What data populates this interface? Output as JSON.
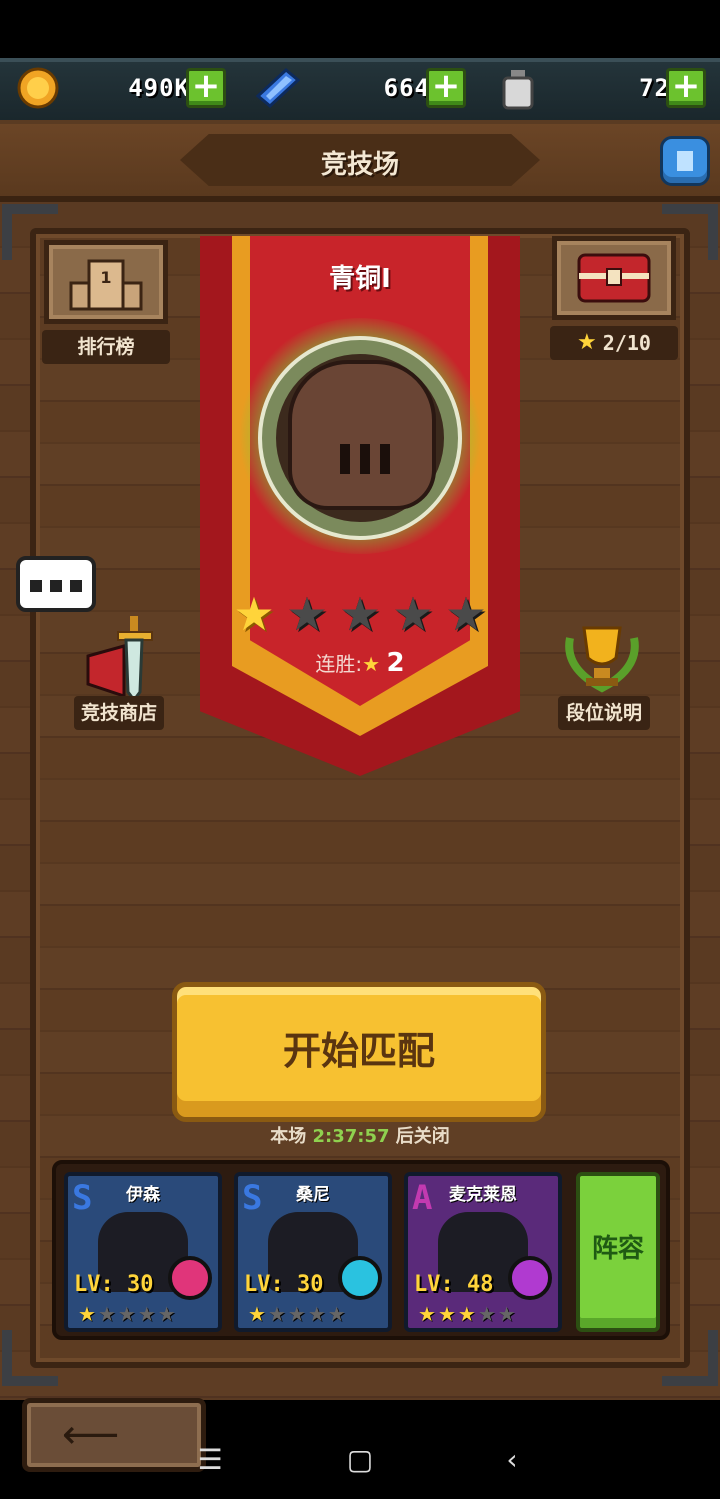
{
  "currencies": [
    {
      "name": "gold",
      "value": "490K",
      "color": "#f0a424"
    },
    {
      "name": "gem",
      "value": "664",
      "color": "#3a78e0"
    },
    {
      "name": "potion",
      "value": "72",
      "color": "#cfcfcf"
    }
  ],
  "header": {
    "title": "竞技场"
  },
  "left_panel": {
    "leaderboard_label": "排行榜",
    "shop_label": "竞技商店"
  },
  "right_panel": {
    "chest_progress": "2/10",
    "rank_info_label": "段位说明"
  },
  "rank": {
    "name": "青铜Ⅰ",
    "stars_filled": 1,
    "stars_total": 5,
    "streak_label": "连胜:",
    "streak_count": "2"
  },
  "match": {
    "start_label": "开始匹配",
    "timer_prefix": "本场",
    "timer_value": "2:37:57",
    "timer_suffix": "后关闭"
  },
  "team": [
    {
      "name": "伊森",
      "grade": "S",
      "level": "LV: 30",
      "stars": 1,
      "color": "#2a4a7a",
      "grade_color": "#3a78e0",
      "badge_color": "#e0357a"
    },
    {
      "name": "桑尼",
      "grade": "S",
      "level": "LV: 30",
      "stars": 1,
      "color": "#2a4a7a",
      "grade_color": "#3a78e0",
      "badge_color": "#2ac2e0"
    },
    {
      "name": "麦克莱恩",
      "grade": "A",
      "level": "LV: 48",
      "stars": 3,
      "color": "#5a2a7a",
      "grade_color": "#c23ab0",
      "badge_color": "#b03ad0"
    }
  ],
  "lineup_label": "阵容",
  "nav": {
    "menu": "☰",
    "home": "▢",
    "back": "‹"
  }
}
